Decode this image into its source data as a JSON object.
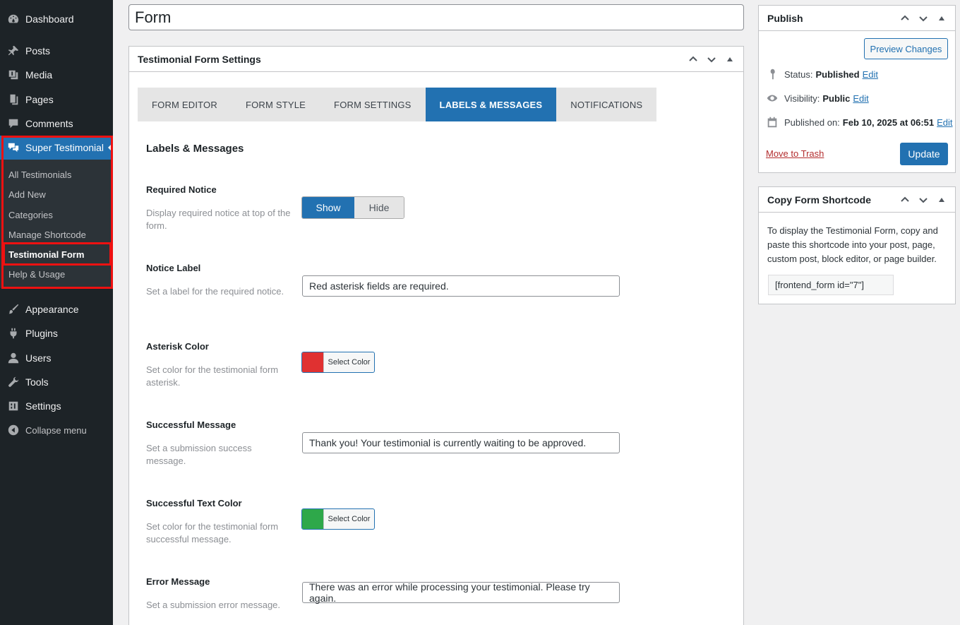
{
  "sidebar": {
    "items": [
      {
        "label": "Dashboard",
        "icon": "dashboard-icon"
      },
      {
        "label": "Posts",
        "icon": "pin-icon"
      },
      {
        "label": "Media",
        "icon": "media-icon"
      },
      {
        "label": "Pages",
        "icon": "pages-icon"
      },
      {
        "label": "Comments",
        "icon": "comment-icon"
      },
      {
        "label": "Super Testimonial",
        "icon": "testimonial-icon"
      },
      {
        "label": "Appearance",
        "icon": "brush-icon"
      },
      {
        "label": "Plugins",
        "icon": "plugin-icon"
      },
      {
        "label": "Users",
        "icon": "user-icon"
      },
      {
        "label": "Tools",
        "icon": "wrench-icon"
      },
      {
        "label": "Settings",
        "icon": "settings-icon"
      },
      {
        "label": "Collapse menu",
        "icon": "collapse-icon"
      }
    ],
    "submenu": [
      {
        "label": "All Testimonials"
      },
      {
        "label": "Add New"
      },
      {
        "label": "Categories"
      },
      {
        "label": "Manage Shortcode"
      },
      {
        "label": "Testimonial Form"
      },
      {
        "label": "Help & Usage"
      }
    ]
  },
  "title": "Form",
  "settings": {
    "heading": "Testimonial Form Settings",
    "tabs": [
      {
        "label": "FORM EDITOR"
      },
      {
        "label": "FORM STYLE"
      },
      {
        "label": "FORM SETTINGS"
      },
      {
        "label": "LABELS & MESSAGES"
      },
      {
        "label": "NOTIFICATIONS"
      }
    ],
    "section_title": "Labels & Messages",
    "fields": [
      {
        "label": "Required Notice",
        "desc": "Display required notice at top of the form.",
        "show": "Show",
        "hide": "Hide"
      },
      {
        "label": "Notice Label",
        "desc": "Set a label for the required notice.",
        "value": "Red asterisk fields are required."
      },
      {
        "label": "Asterisk Color",
        "desc": "Set color for the testimonial form asterisk.",
        "button": "Select Color",
        "color": "#e03131"
      },
      {
        "label": "Successful Message",
        "desc": "Set a submission success message.",
        "value": "Thank you! Your testimonial is currently waiting to be approved."
      },
      {
        "label": "Successful Text Color",
        "desc": "Set color for the testimonial form successful message.",
        "button": "Select Color",
        "color": "#2ea84a"
      },
      {
        "label": "Error Message",
        "desc": "Set a submission error message.",
        "value": "There was an error while processing your testimonial. Please try again."
      }
    ]
  },
  "publish": {
    "heading": "Publish",
    "preview": "Preview Changes",
    "status_label": "Status:",
    "status_value": "Published",
    "visibility_label": "Visibility:",
    "visibility_value": "Public",
    "published_label": "Published on:",
    "published_value": "Feb 10, 2025 at 06:51",
    "edit": "Edit",
    "trash": "Move to Trash",
    "update": "Update"
  },
  "shortcode": {
    "heading": "Copy Form Shortcode",
    "desc": "To display the Testimonial Form, copy and paste this shortcode into your post, page, custom post, block editor, or page builder.",
    "code": "[frontend_form id=\"7\"]"
  },
  "colors": {
    "accent": "#2271b1",
    "sidebar": "#1d2327",
    "highlight": "#e11111"
  }
}
